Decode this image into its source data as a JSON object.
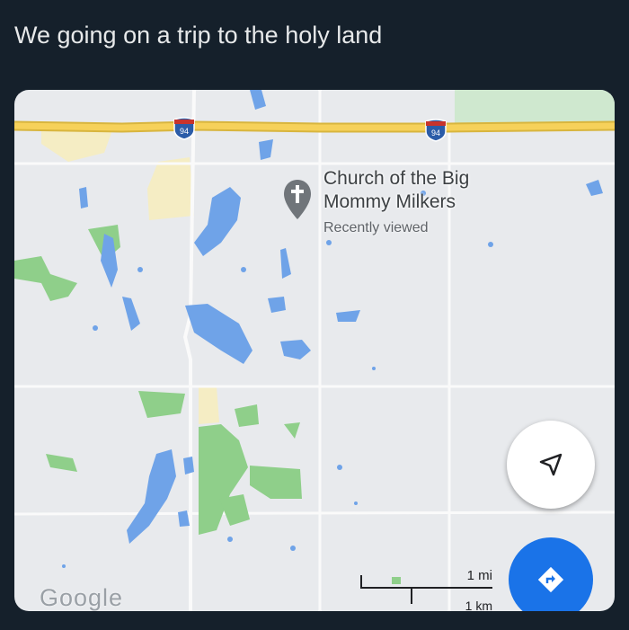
{
  "post": {
    "text": "We going on a trip to the holy land"
  },
  "map": {
    "highway_shield_label": "94",
    "place": {
      "name_line1": "Church of the Big",
      "name_line2": "Mommy Milkers",
      "subtitle": "Recently viewed",
      "icon": "church-cross-pin-icon"
    },
    "scale": {
      "miles": "1 mi",
      "km": "1 km"
    },
    "logo": "Google",
    "compass_icon": "navigation-arrow-icon",
    "directions_icon": "directions-icon"
  },
  "colors": {
    "background": "#15202b",
    "map_land": "#e8eaed",
    "water": "#6fa3e8",
    "park": "#7cc47f",
    "highway": "#f2c94c",
    "directions_button": "#1a73e8"
  }
}
